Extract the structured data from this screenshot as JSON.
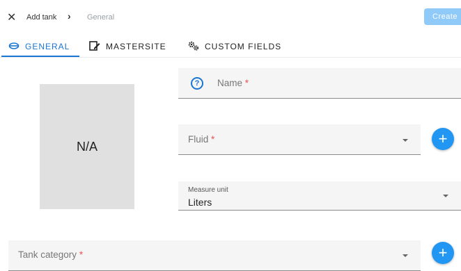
{
  "header": {
    "breadcrumb": [
      "Add tank",
      "General"
    ],
    "create_label": "Create"
  },
  "tabs": [
    {
      "label": "GENERAL",
      "active": true,
      "icon": "tank-icon"
    },
    {
      "label": "MASTERSITE",
      "active": false,
      "icon": "site-edit-icon"
    },
    {
      "label": "CUSTOM FIELDS",
      "active": false,
      "icon": "gears-icon"
    }
  ],
  "image_placeholder": "N/A",
  "form": {
    "name": {
      "label": "Name",
      "required_mark": "*"
    },
    "fluid": {
      "label": "Fluid",
      "required_mark": "*"
    },
    "measure_unit": {
      "label": "Measure unit",
      "value": "Liters"
    },
    "tank_category": {
      "label": "Tank category",
      "required_mark": "*"
    }
  },
  "colors": {
    "primary": "#1976d2",
    "fab": "#2196f3",
    "create_disabled": "#90caf9",
    "required": "#ef5350"
  }
}
